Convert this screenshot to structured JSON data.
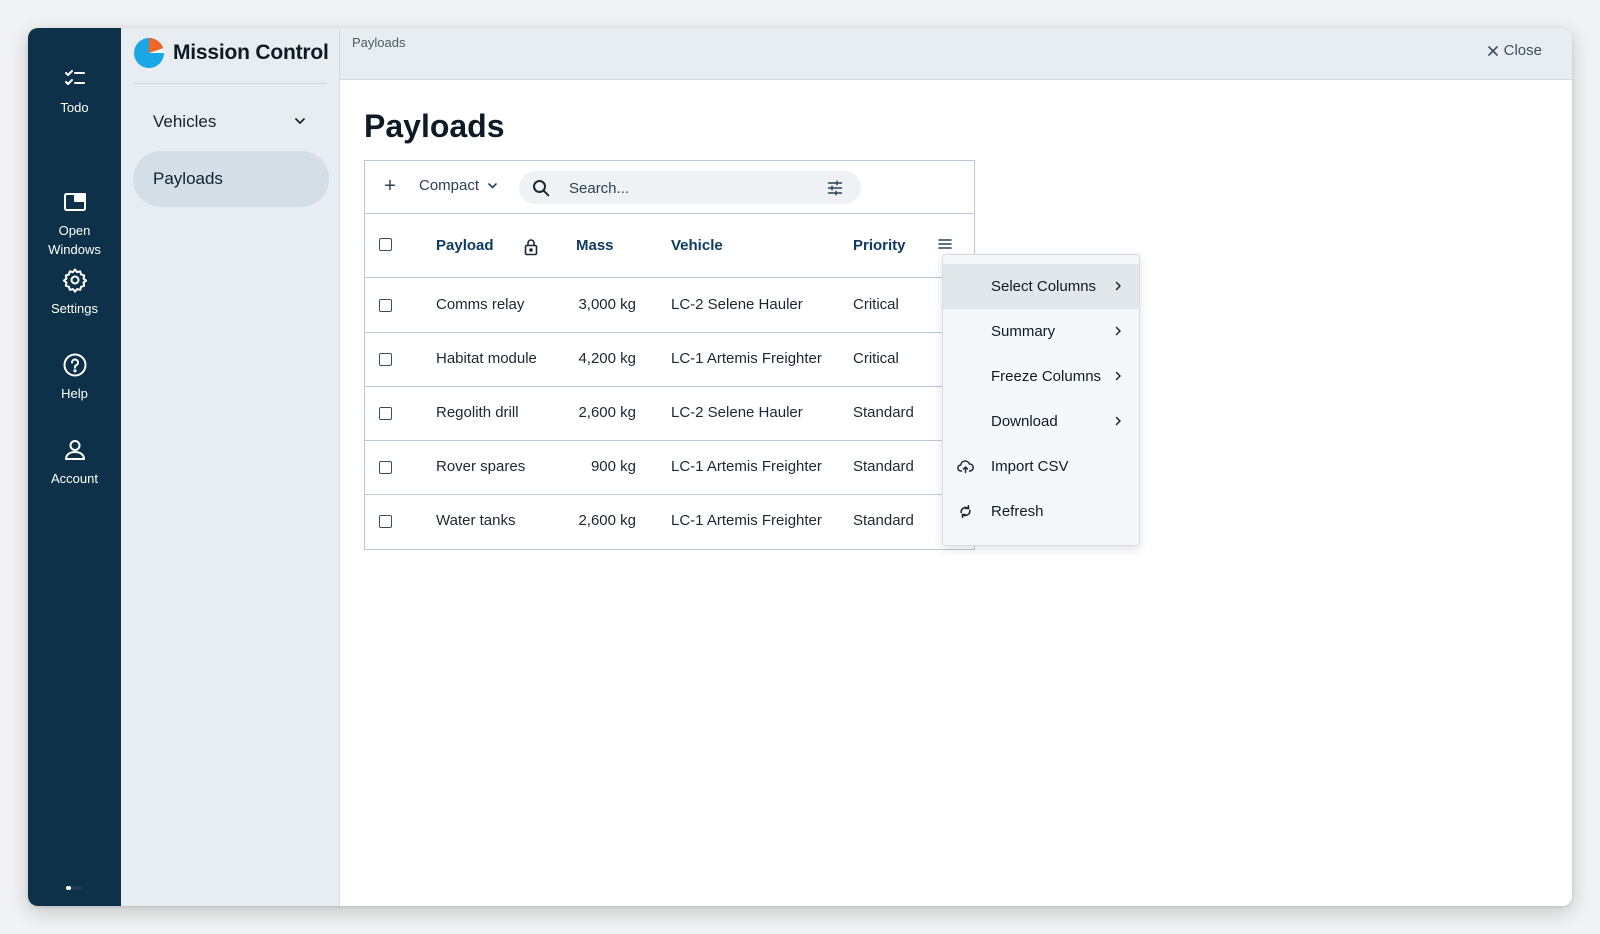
{
  "rail": {
    "items": [
      {
        "label": "Todo",
        "icon": "checklist-icon"
      },
      {
        "label": "Open\nWindows",
        "icon": "window-icon"
      },
      {
        "label": "Settings",
        "icon": "gear-icon"
      },
      {
        "label": "Help",
        "icon": "help-circle-icon"
      },
      {
        "label": "Account",
        "icon": "user-icon"
      }
    ],
    "background": "#0d3148"
  },
  "brand": {
    "name": "Mission Control",
    "logo_colors": [
      "#1aa7e8",
      "#f26522"
    ]
  },
  "subnav": {
    "items": [
      {
        "label": "Vehicles",
        "expandable": true,
        "active": false
      },
      {
        "label": "Payloads",
        "expandable": false,
        "active": true
      }
    ]
  },
  "topbar": {
    "breadcrumb": "Payloads",
    "close_label": "Close"
  },
  "page": {
    "title": "Payloads"
  },
  "toolbar": {
    "add_icon": "plus-icon",
    "density_label": "Compact",
    "search_placeholder": "Search..."
  },
  "table": {
    "columns": [
      "Payload",
      "Mass",
      "Vehicle",
      "Priority"
    ],
    "locked_column": "Payload",
    "rows": [
      {
        "payload": "Comms relay",
        "mass": "3,000 kg",
        "vehicle": "LC-2 Selene Hauler",
        "priority": "Critical"
      },
      {
        "payload": "Habitat module",
        "mass": "4,200 kg",
        "vehicle": "LC-1 Artemis Freighter",
        "priority": "Critical"
      },
      {
        "payload": "Regolith drill",
        "mass": "2,600 kg",
        "vehicle": "LC-2 Selene Hauler",
        "priority": "Standard"
      },
      {
        "payload": "Rover spares",
        "mass": "900 kg",
        "vehicle": "LC-1 Artemis Freighter",
        "priority": "Standard"
      },
      {
        "payload": "Water tanks",
        "mass": "2,600 kg",
        "vehicle": "LC-1 Artemis Freighter",
        "priority": "Standard"
      }
    ]
  },
  "column_menu": {
    "items": [
      {
        "label": "Select Columns",
        "submenu": true,
        "highlighted": true
      },
      {
        "label": "Summary",
        "submenu": true
      },
      {
        "label": "Freeze Columns",
        "submenu": true
      },
      {
        "label": "Download",
        "submenu": true
      },
      {
        "label": "Import CSV",
        "icon": "cloud-upload-icon"
      },
      {
        "label": "Refresh",
        "icon": "refresh-icon"
      }
    ]
  },
  "colors": {
    "accent": "#0d3b63",
    "header_text": "#0d3b63",
    "border": "#b8c8d6"
  }
}
